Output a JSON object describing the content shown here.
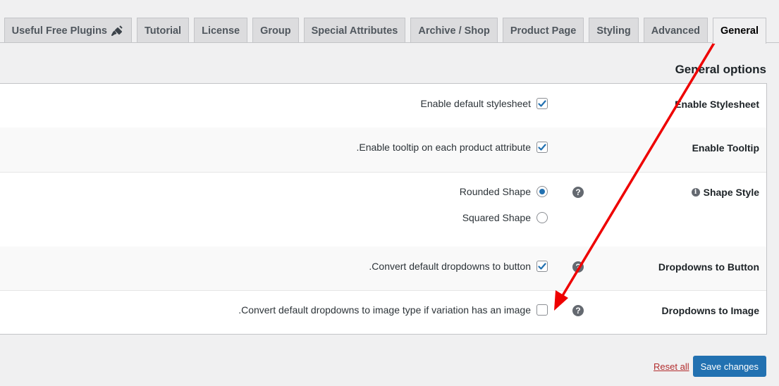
{
  "tabs": [
    {
      "label": "Useful Free Plugins",
      "icon": "plug-icon",
      "active": false
    },
    {
      "label": "Tutorial",
      "active": false
    },
    {
      "label": "License",
      "active": false
    },
    {
      "label": "Group",
      "active": false
    },
    {
      "label": "Special Attributes",
      "active": false
    },
    {
      "label": "Archive / Shop",
      "active": false
    },
    {
      "label": "Product Page",
      "active": false
    },
    {
      "label": "Styling",
      "active": false
    },
    {
      "label": "Advanced",
      "active": false
    },
    {
      "label": "General",
      "active": true
    }
  ],
  "section": {
    "title": "General options"
  },
  "settings": {
    "stylesheet": {
      "label": "Enable Stylesheet",
      "option": "Enable default stylesheet",
      "checked": true
    },
    "tooltip": {
      "label": "Enable Tooltip",
      "option": ".Enable tooltip on each product attribute",
      "checked": true
    },
    "shape": {
      "label": "Shape Style",
      "options": [
        {
          "label": "Rounded Shape",
          "selected": true
        },
        {
          "label": "Squared Shape",
          "selected": false
        }
      ]
    },
    "dropdown_button": {
      "label": "Dropdowns to Button",
      "option": ".Convert default dropdowns to button",
      "checked": true
    },
    "dropdown_image": {
      "label": "Dropdowns to Image",
      "option": ".Convert default dropdowns to image type if variation has an image",
      "checked": false
    }
  },
  "help_glyph": "?",
  "info_glyph": "i",
  "actions": {
    "reset": "Reset all",
    "save": "Save changes"
  },
  "colors": {
    "accent": "#2271b1",
    "annotation_arrow": "#ee0000",
    "reset": "#b32d2e"
  }
}
